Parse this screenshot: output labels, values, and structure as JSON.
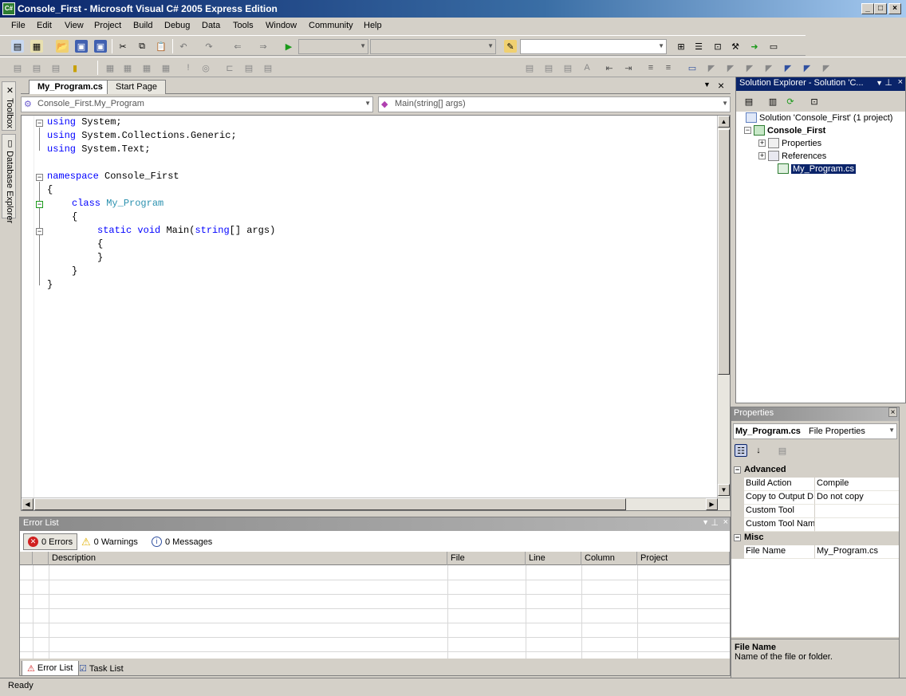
{
  "window": {
    "title": "Console_First - Microsoft Visual C# 2005 Express Edition",
    "app_icon": "C#"
  },
  "menu": [
    "File",
    "Edit",
    "View",
    "Project",
    "Build",
    "Debug",
    "Data",
    "Tools",
    "Window",
    "Community",
    "Help"
  ],
  "left_dock": {
    "toolbox": "Toolbox",
    "database_explorer": "Database Explorer"
  },
  "editor": {
    "tabs": [
      {
        "label": "My_Program.cs",
        "active": true
      },
      {
        "label": "Start Page",
        "active": false
      }
    ],
    "type_dropdown": "Console_First.My_Program",
    "member_dropdown": "Main(string[] args)",
    "code": {
      "l1_kw": "using",
      "l1_rest": " System;",
      "l2_kw": "using",
      "l2_rest": " System.Collections.Generic;",
      "l3_kw": "using",
      "l3_rest": " System.Text;",
      "l5_kw": "namespace",
      "l5_rest": " Console_First",
      "l6": "{",
      "l7_kw": "class",
      "l7_type": "My_Program",
      "l8": "{",
      "l9_kw1": "static",
      "l9_kw2": "void",
      "l9_name": "Main(",
      "l9_kw3": "string",
      "l9_rest": "[] args)",
      "l10": "{",
      "l11": "}",
      "l12": "}",
      "l13": "}"
    }
  },
  "error_list": {
    "title": "Error List",
    "errors_label": "0 Errors",
    "warnings_label": "0 Warnings",
    "messages_label": "0 Messages",
    "columns": [
      "Description",
      "File",
      "Line",
      "Column",
      "Project"
    ],
    "bottom_tabs": [
      "Error List",
      "Task List"
    ]
  },
  "solution_explorer": {
    "title": "Solution Explorer - Solution 'C...",
    "solution": "Solution 'Console_First' (1 project)",
    "project": "Console_First",
    "items": [
      "Properties",
      "References",
      "My_Program.cs"
    ]
  },
  "properties": {
    "title": "Properties",
    "object_name": "My_Program.cs",
    "object_type": "File Properties",
    "categories": [
      {
        "name": "Advanced",
        "rows": [
          {
            "name": "Build Action",
            "value": "Compile"
          },
          {
            "name": "Copy to Output D",
            "value": "Do not copy"
          },
          {
            "name": "Custom Tool",
            "value": ""
          },
          {
            "name": "Custom Tool Name",
            "value": ""
          }
        ]
      },
      {
        "name": "Misc",
        "rows": [
          {
            "name": "File Name",
            "value": "My_Program.cs"
          }
        ]
      }
    ],
    "description_title": "File Name",
    "description_text": "Name of the file or folder."
  },
  "status": {
    "text": "Ready"
  },
  "colors": {
    "keyword": "#0000ff",
    "type": "#2b91af",
    "title_bar": "#0a246a",
    "selection": "#0a246a"
  }
}
